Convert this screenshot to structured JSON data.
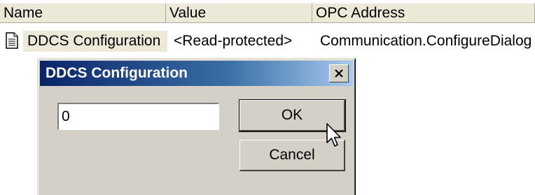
{
  "columns": {
    "name": "Name",
    "value": "Value",
    "opc_address": "OPC Address"
  },
  "row": {
    "icon": "document-icon",
    "name": "DDCS Configuration",
    "value": "<Read-protected>",
    "opc_address": "Communication.ConfigureDialog"
  },
  "dialog": {
    "title": "DDCS Configuration",
    "input_value": "0",
    "ok_label": "OK",
    "cancel_label": "Cancel"
  },
  "colors": {
    "titlebar_start": "#0a246a",
    "titlebar_end": "#a6caf0",
    "header_bg": "#ece9d8",
    "dialog_bg": "#d4d0c8"
  }
}
